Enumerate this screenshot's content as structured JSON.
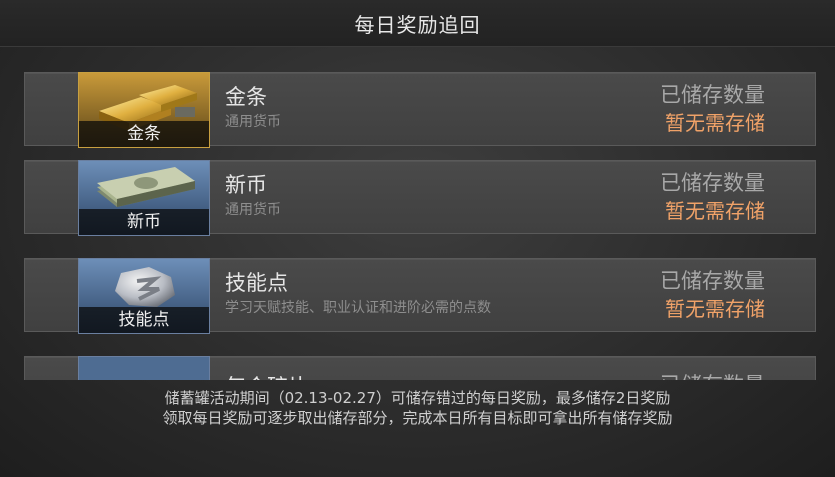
{
  "header": {
    "title": "每日奖励追回"
  },
  "items": [
    {
      "name": "金条",
      "icon_label": "金条",
      "desc": "通用货币",
      "stored_label": "已储存数量",
      "stored_value": "暂无需存储",
      "icon": "gold-bar-icon"
    },
    {
      "name": "新币",
      "icon_label": "新币",
      "desc": "通用货币",
      "stored_label": "已储存数量",
      "stored_value": "暂无需存储",
      "icon": "banknote-icon"
    },
    {
      "name": "技能点",
      "icon_label": "技能点",
      "desc": "学习天赋技能、职业认证和进阶必需的点数",
      "stored_label": "已储存数量",
      "stored_value": "暂无需存储",
      "icon": "skill-coin-icon"
    },
    {
      "name": "年会碎片",
      "stored_label": "已储存数量",
      "icon": "item-icon"
    }
  ],
  "footer": {
    "line1": "储蓄罐活动期间（02.13-02.27）可储存错过的每日奖励，最多储存2日奖励",
    "line2": "领取每日奖励可逐步取出储存部分，完成本日所有目标即可拿出所有储存奖励"
  },
  "colors": {
    "accent_value": "#f0a268",
    "gold_border": "#c8a040",
    "blue_border": "#6a7fa0"
  }
}
